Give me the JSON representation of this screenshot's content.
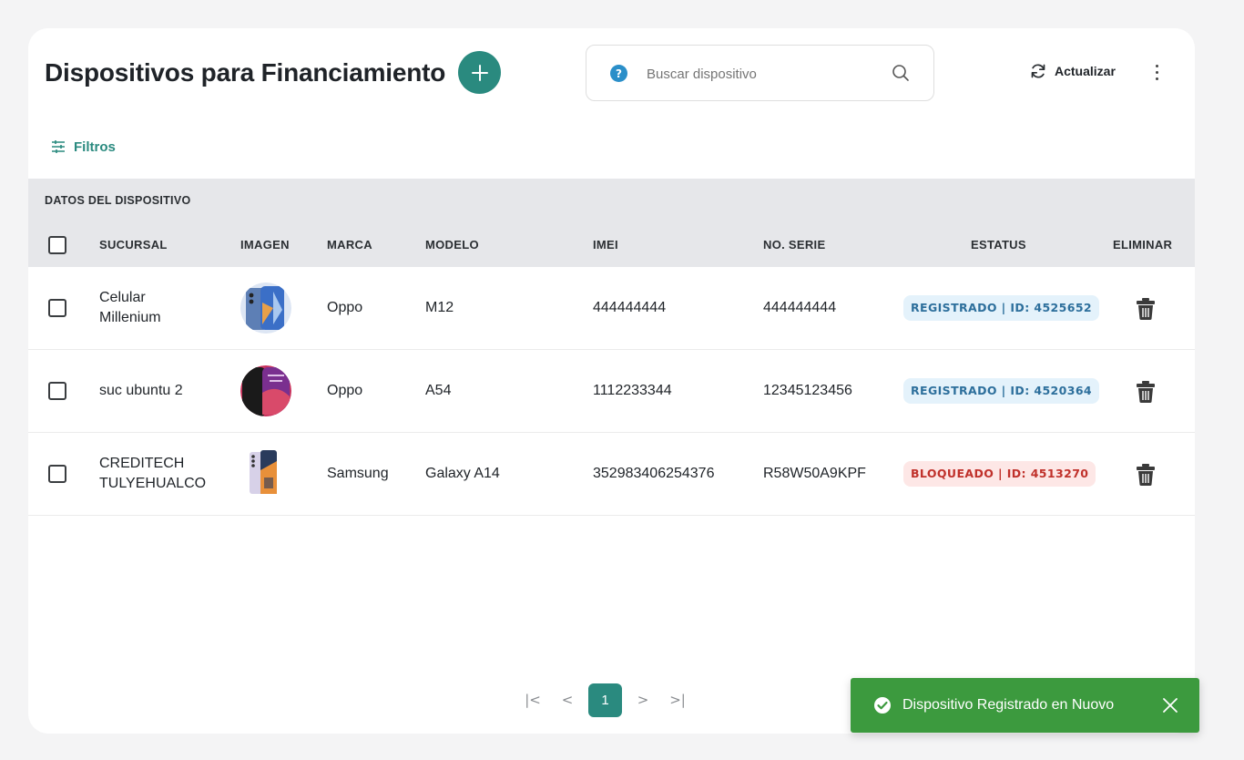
{
  "header": {
    "title": "Dispositivos para Financiamiento",
    "add_icon": "plus-icon",
    "search": {
      "placeholder": "Buscar dispositivo",
      "help_icon": "question-circle-icon",
      "search_icon": "magnifier-icon"
    },
    "refresh_label": "Actualizar",
    "more_icon": "vertical-dots-icon"
  },
  "filters_label": "Filtros",
  "table": {
    "group_label": "DATOS DEL DISPOSITIVO",
    "columns": [
      "SUCURSAL",
      "IMAGEN",
      "MARCA",
      "MODELO",
      "IMEI",
      "NO. SERIE",
      "ESTATUS",
      "ELIMINAR"
    ],
    "rows": [
      {
        "sucursal": "Celular Millenium",
        "marca": "Oppo",
        "modelo": "M12",
        "imei": "444444444",
        "serie": "444444444",
        "estatus": "REGISTRADO | ID: 4525652",
        "status_type": "registrado"
      },
      {
        "sucursal": "suc ubuntu 2",
        "marca": "Oppo",
        "modelo": "A54",
        "imei": "1112233344",
        "serie": "12345123456",
        "estatus": "REGISTRADO | ID: 4520364",
        "status_type": "registrado"
      },
      {
        "sucursal": "CREDITECH TULYEHUALCO",
        "marca": "Samsung",
        "modelo": "Galaxy A14",
        "imei": "352983406254376",
        "serie": "R58W50A9KPF",
        "estatus": "BLOQUEADO | ID: 4513270",
        "status_type": "bloqueado"
      }
    ]
  },
  "pagination": {
    "first": "|<",
    "prev": "<",
    "current_page": "1",
    "next": ">",
    "last": ">|"
  },
  "toast": {
    "message": "Dispositivo Registrado en Nuovo",
    "icon": "check-circle-icon",
    "close_icon": "close-icon"
  },
  "colors": {
    "accent": "#2a8a7f",
    "toast": "#3c9a3e",
    "registered_bg": "#e4f2fb",
    "registered_text": "#2d6f9c",
    "blocked_bg": "#fde7e6",
    "blocked_text": "#c0312b"
  }
}
